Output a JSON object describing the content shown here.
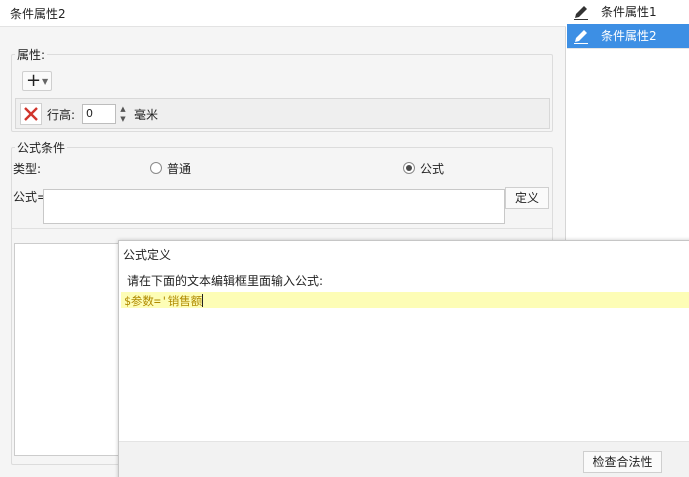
{
  "editor": {
    "title": "条件属性2",
    "properties": {
      "legend": "属性:",
      "row_height": {
        "label": "行高:",
        "value": "0",
        "unit": "毫米"
      }
    },
    "formula_condition": {
      "legend": "公式条件",
      "type_label": "类型:",
      "type_options": [
        {
          "label": "普通",
          "selected": false
        },
        {
          "label": "公式",
          "selected": true
        }
      ],
      "formula_label": "公式=",
      "formula_value": "",
      "define_button": "定义"
    }
  },
  "sidebar": {
    "items": [
      {
        "label": "条件属性1",
        "selected": false,
        "icon": "edit-pencil-icon"
      },
      {
        "label": "条件属性2",
        "selected": true,
        "icon": "edit-pencil-icon"
      }
    ]
  },
  "dialog": {
    "title": "公式定义",
    "instruction": "请在下面的文本编辑框里面输入公式:",
    "formula_text": "$参数='销售额",
    "check_button": "检查合法性"
  },
  "colors": {
    "accent": "#3d8fe4",
    "delete_red": "#d0342c",
    "code_highlight": "#fdfdb6",
    "code_text": "#b08a00"
  }
}
